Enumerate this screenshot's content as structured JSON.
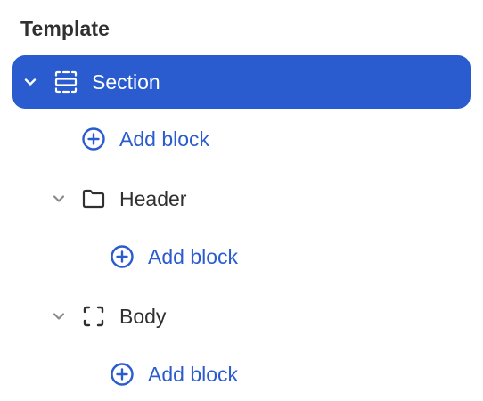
{
  "panel": {
    "title": "Template"
  },
  "tree": {
    "section": {
      "label": "Section",
      "icon": "section-icon",
      "expanded": true,
      "selected": true
    },
    "section_add": {
      "label": "Add block",
      "icon": "plus-circle-icon"
    },
    "header": {
      "label": "Header",
      "icon": "folder-icon",
      "expanded": true
    },
    "header_add": {
      "label": "Add block",
      "icon": "plus-circle-icon"
    },
    "body": {
      "label": "Body",
      "icon": "dashed-square-icon",
      "expanded": true
    },
    "body_add": {
      "label": "Add block",
      "icon": "plus-circle-icon"
    }
  },
  "colors": {
    "accent": "#2a5ccf",
    "text": "#303030",
    "muted_icon": "#8a8a8a",
    "background": "#ffffff"
  }
}
